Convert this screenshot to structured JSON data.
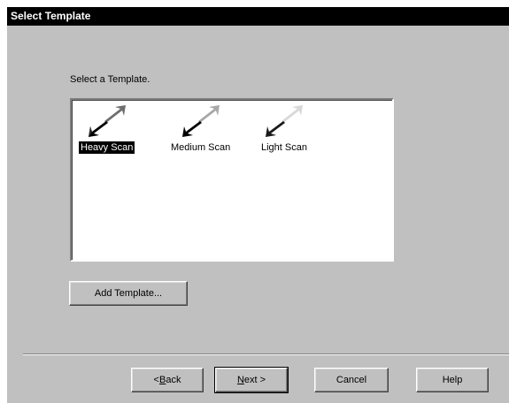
{
  "window": {
    "title": "Select Template"
  },
  "dialog": {
    "prompt": "Select a Template.",
    "templates": [
      {
        "label": "Heavy Scan",
        "icon": "heavy-scan-icon",
        "selected": true
      },
      {
        "label": "Medium Scan",
        "icon": "medium-scan-icon",
        "selected": false
      },
      {
        "label": "Light Scan",
        "icon": "light-scan-icon",
        "selected": false
      }
    ],
    "add_template_label": "Add Template..."
  },
  "buttons": {
    "back_accel": "B",
    "back_rest": "ack",
    "back_prefix": "< ",
    "next_accel": "N",
    "next_rest": "ext >",
    "cancel": "Cancel",
    "help": "Help"
  },
  "colors": {
    "dialog_bg": "#c0c0c0",
    "titlebar_bg": "#000000",
    "selection_bg": "#000000"
  }
}
